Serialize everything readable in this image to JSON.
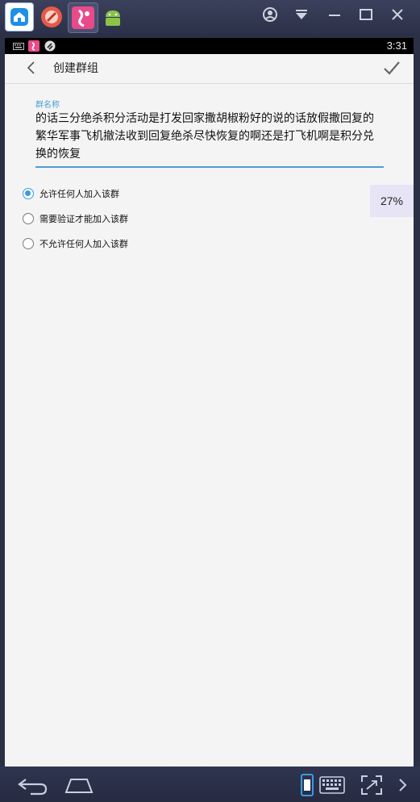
{
  "app_bar": {
    "title": "创建群组"
  },
  "status_bar": {
    "time": "3:31"
  },
  "form": {
    "name_label": "群名称",
    "name_value": "的话三分绝杀积分活动是打发回家撒胡椒粉好的说的话放假撒回复的繁华军事飞机撤法收到回复绝杀尽快恢复的啊还是打飞机啊是积分兑换的恢复"
  },
  "join_options": [
    {
      "label": "允许任何人加入该群",
      "checked": true
    },
    {
      "label": "需要验证才能加入该群",
      "checked": false
    },
    {
      "label": "不允许任何人加入该群",
      "checked": false
    }
  ],
  "progress": {
    "text": "27%"
  },
  "colors": {
    "accent": "#3a9ae0",
    "screen_bg": "#f4f4f4",
    "emulator_bar": "#2b3046"
  },
  "icons": {
    "back": "chevron-left-icon",
    "confirm": "check-icon"
  }
}
